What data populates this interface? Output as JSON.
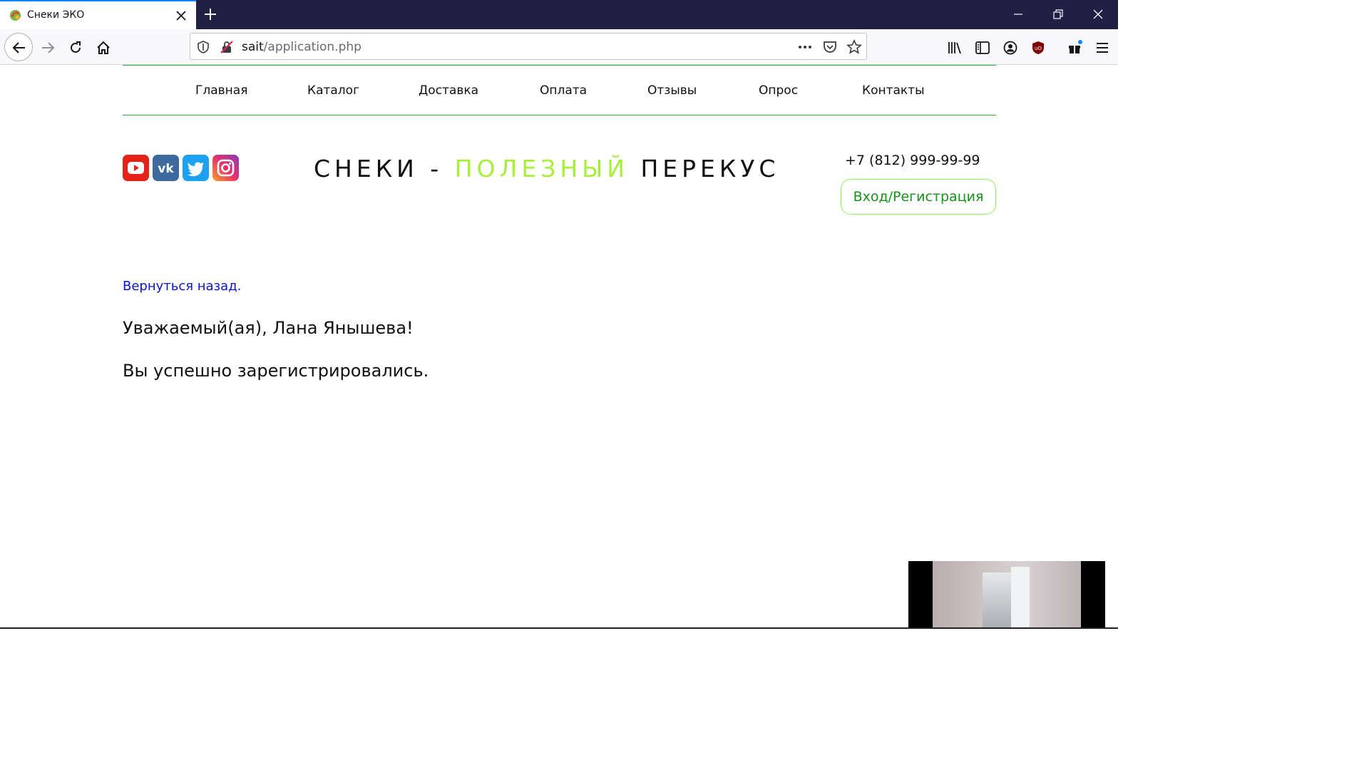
{
  "browser": {
    "tab_title": "Снеки ЭКО",
    "url_host": "sait",
    "url_path": "/application.php"
  },
  "nav": {
    "items": [
      "Главная",
      "Каталог",
      "Доставка",
      "Оплата",
      "Отзывы",
      "Опрос",
      "Контакты"
    ]
  },
  "header": {
    "title_part1": "СНЕКИ - ",
    "title_accent": "ПОЛЕЗНЫЙ",
    "title_part2": " ПЕРЕКУС",
    "phone": "+7 (812) 999-99-99",
    "login_label": "Вход/Регистрация",
    "socials": [
      "youtube-icon",
      "vk-icon",
      "twitter-icon",
      "instagram-icon"
    ]
  },
  "content": {
    "back_link": "Вернуться назад.",
    "greeting": "Уважаемый(ая), Лана Янышева!",
    "message": "Вы успешно зарегистрировались."
  },
  "colors": {
    "accent_green": "#a6f03a",
    "menu_line": "#2eaa3d",
    "link_blue": "#0a14d6",
    "button_text": "#16911a"
  }
}
